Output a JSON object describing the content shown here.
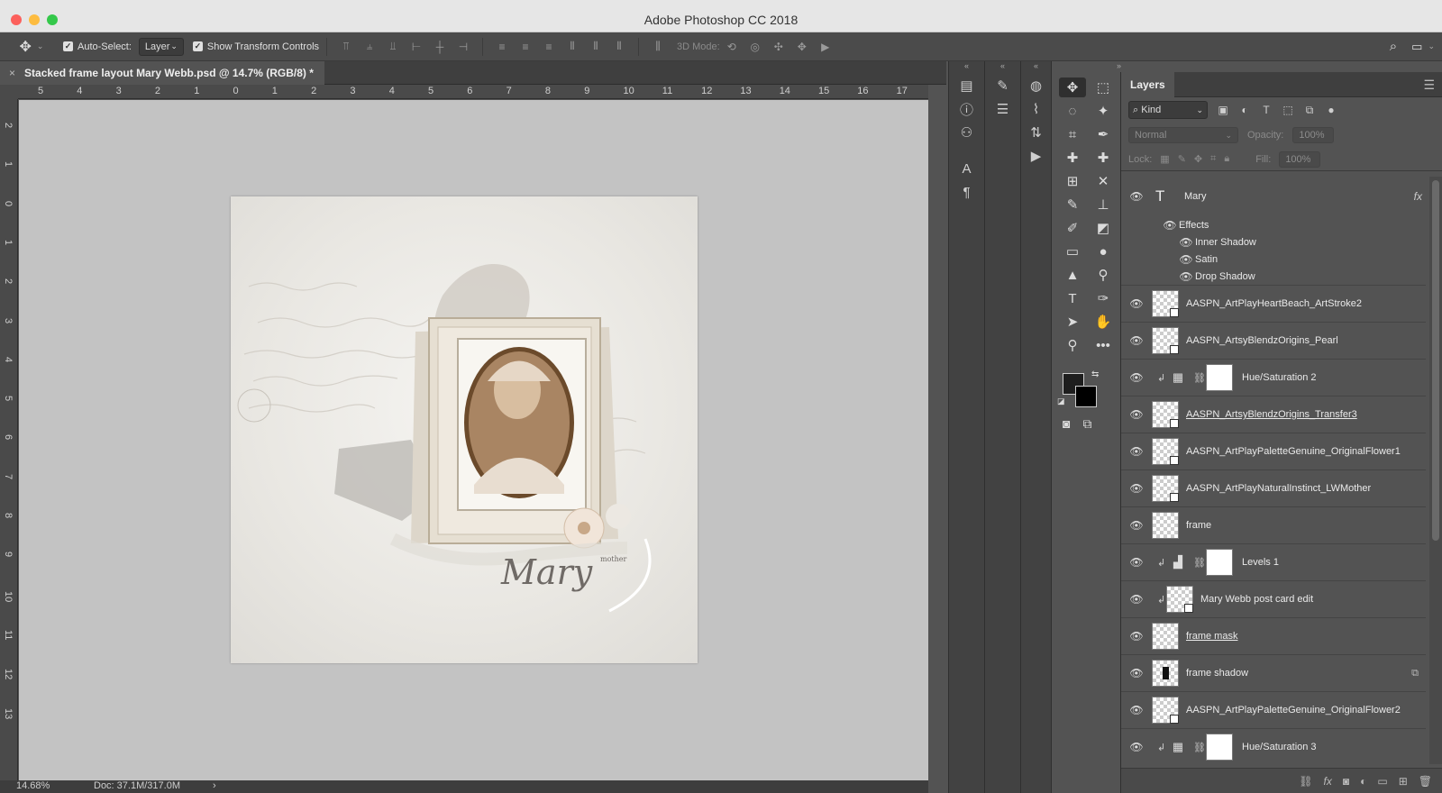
{
  "window": {
    "title": "Adobe Photoshop CC 2018",
    "traffic_colors": [
      "#fc605c",
      "#fdbc40",
      "#34c84a"
    ]
  },
  "options_bar": {
    "auto_select_label": "Auto-Select:",
    "auto_select_value": "Layer",
    "transform_label": "Show Transform Controls",
    "mode_3d_label": "3D Mode:"
  },
  "document": {
    "tab_title": "Stacked frame layout Mary Webb.psd @ 14.7% (RGB/8) *",
    "close_glyph": "×"
  },
  "rulers": {
    "horizontal": [
      "5",
      "4",
      "3",
      "2",
      "1",
      "0",
      "1",
      "2",
      "3",
      "4",
      "5",
      "6",
      "7",
      "8",
      "9",
      "10",
      "11",
      "12",
      "13",
      "14",
      "15",
      "16",
      "17"
    ],
    "vertical": [
      "2",
      "1",
      "0",
      "1",
      "2",
      "3",
      "4",
      "5",
      "6",
      "7",
      "8",
      "9",
      "10",
      "11",
      "12",
      "13"
    ]
  },
  "artwork": {
    "name_script": "Mary",
    "caption": "mother"
  },
  "status_bar": {
    "zoom": "14.68%",
    "doc_size": "Doc: 37.1M/317.0M",
    "arrow": "›"
  },
  "layers_panel": {
    "tab_label": "Layers",
    "kind_label": "Kind",
    "blend_mode": "Normal",
    "opacity_label": "Opacity:",
    "opacity_value": "100%",
    "lock_label": "Lock:",
    "fill_label": "Fill:",
    "fill_value": "100%",
    "type_layer": {
      "name": "Mary",
      "fx": "fx",
      "effects_label": "Effects",
      "effects": [
        "Inner Shadow",
        "Satin",
        "Drop Shadow"
      ]
    },
    "layers": [
      {
        "name": "AASPN_ArtPlayHeartBeach_ArtStroke2",
        "kind": "smart"
      },
      {
        "name": "AASPN_ArtsyBlendzOrigins_Pearl",
        "kind": "smart"
      },
      {
        "name": "Hue/Saturation 2",
        "kind": "adjustment-hue",
        "clipped": true
      },
      {
        "name": "AASPN_ArtsyBlendzOrigins_Transfer3",
        "kind": "smart",
        "underlined": true
      },
      {
        "name": "AASPN_ArtPlayPaletteGenuine_OriginalFlower1",
        "kind": "smart"
      },
      {
        "name": "AASPN_ArtPlayNaturalInstinct_LWMother",
        "kind": "smart"
      },
      {
        "name": "frame",
        "kind": "pixel"
      },
      {
        "name": "Levels 1",
        "kind": "adjustment-levels",
        "clipped": true
      },
      {
        "name": "Mary Webb post card edit",
        "kind": "smart-clipped",
        "clipped": true
      },
      {
        "name": "frame mask",
        "kind": "pixel",
        "underlined": true
      },
      {
        "name": "frame shadow",
        "kind": "pixel-dark"
      },
      {
        "name": "AASPN_ArtPlayPaletteGenuine_OriginalFlower2",
        "kind": "smart"
      },
      {
        "name": "Hue/Saturation 3",
        "kind": "adjustment-hue",
        "clipped": true
      }
    ]
  }
}
